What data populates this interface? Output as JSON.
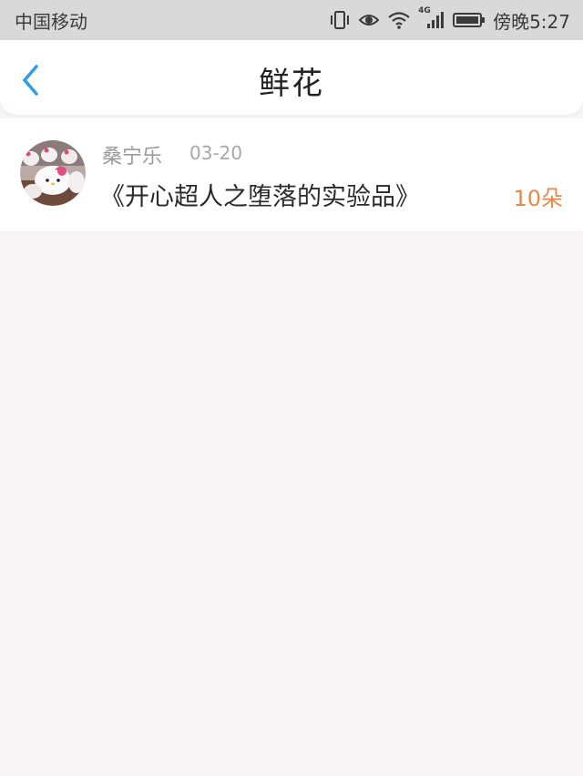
{
  "status_bar": {
    "carrier": "中国移动",
    "network": "4G",
    "time": "傍晚5:27",
    "icons": [
      "vibrate-icon",
      "eye-icon",
      "wifi-icon",
      "signal-icon",
      "battery-icon"
    ]
  },
  "header": {
    "title": "鲜花",
    "back_icon": "chevron-left-icon",
    "accent_color": "#2aa0e0"
  },
  "list": {
    "items": [
      {
        "user": "桑宁乐",
        "date": "03-20",
        "title": "《开心超人之堕落的实验品》",
        "count": "10朵",
        "avatar": "hello-kitty-mugs-photo"
      }
    ]
  },
  "colors": {
    "count": "#e8874a",
    "background": "#f7f5f6"
  }
}
